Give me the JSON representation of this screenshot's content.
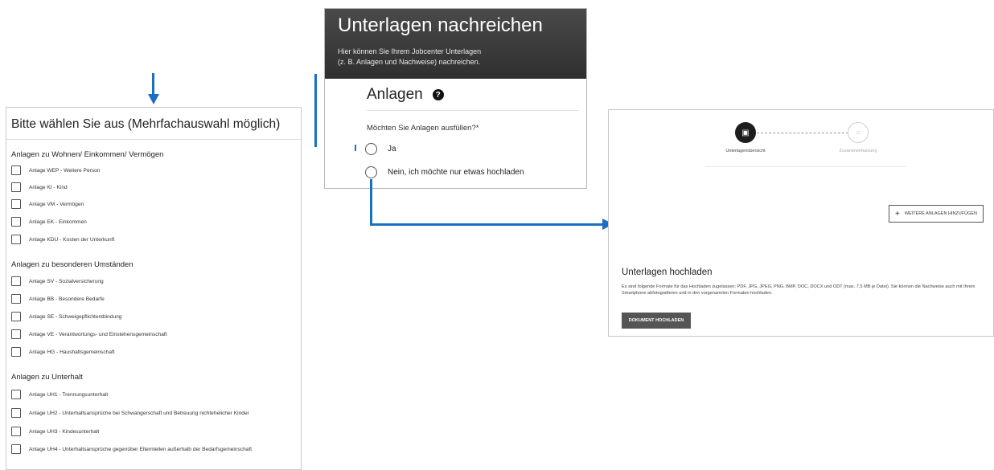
{
  "colors": {
    "accent": "#1b6fc2",
    "header_bg": "#3e3e3e",
    "button_dark": "#555555"
  },
  "left_panel": {
    "title": "Bitte wählen Sie aus (Mehrfachauswahl möglich)",
    "sections": [
      {
        "heading": "Anlagen zu Wohnen/ Einkommen/ Vermögen",
        "items": [
          "Anlage WEP - Weitere Person",
          "Anlage KI - Kind",
          "Anlage VM - Vermögen",
          "Anlage EK - Einkommen",
          "Anlage KDU - Kosten der Unterkunft"
        ]
      },
      {
        "heading": "Anlagen zu besonderen Umständen",
        "items": [
          "Anlage SV - Sozialversicherung",
          "Anlage BB - Besondere Bedarfe",
          "Anlage SE - Schweigepflichtentbindung",
          "Anlage VE - Verantwortungs- und Einstehensgemeinschaft",
          "Anlage HG - Haushaltsgemeinschaft"
        ]
      },
      {
        "heading": "Anlagen zu Unterhalt",
        "items": [
          "Anlage UH1 - Trennungsunterhalt",
          "Anlage UH2 - Unterhaltsansprüche bei Schwangerschaft und Betreuung nichtehelicher Kinder",
          "Anlage UH3 - Kindesunterhalt",
          "Anlage UH4 - Unterhaltsansprüche gegenüber Elternteilen außerhalb der Bedarfsgemeinschaft"
        ]
      }
    ]
  },
  "middle_panel": {
    "title": "Unterlagen nachreichen",
    "subtitle_line1": "Hier können Sie Ihrem Jobcenter Unterlagen",
    "subtitle_line2": "(z. B. Anlagen und Nachweise) nachreichen.",
    "section_title": "Anlagen",
    "help_icon": "question-circle-icon",
    "help_glyph": "?",
    "question": "Möchten Sie Anlagen ausfüllen?*",
    "options": [
      "Ja",
      "Nein, ich möchte nur etwas hochladen"
    ]
  },
  "right_panel": {
    "stepper": [
      {
        "label": "Unterlagenübersicht",
        "icon": "document-icon",
        "active": true
      },
      {
        "label": "Zusammenfassung",
        "icon": "chat-bubble-icon",
        "active": false
      }
    ],
    "add_button": "WEITERE ANLAGEN HINZUFÜGEN",
    "add_icon": "+",
    "upload_heading": "Unterlagen hochladen",
    "upload_text": "Es sind folgende Formate für das Hochladen zugelassen: PDF, JPG, JPEG, PNG, BMP, DOC, DOCX und ODT (max. 7,5 MB je Datei). Sie können die Nachweise auch mit Ihrem Smartphone abfotografieren und in den vorgenannten Formaten hochladen.",
    "upload_button": "DOKUMENT HOCHLADEN"
  }
}
